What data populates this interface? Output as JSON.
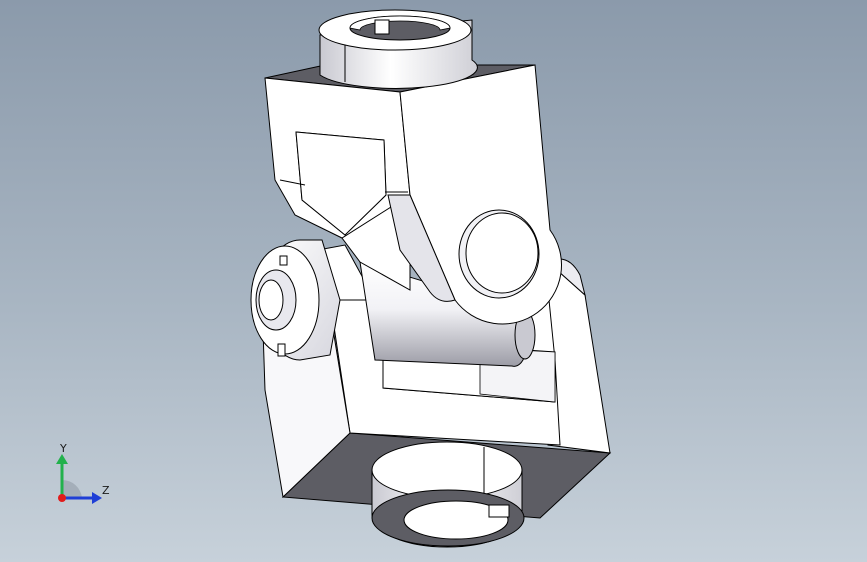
{
  "viewport": {
    "background_top": "#8b9aab",
    "background_bottom": "#c7d1da",
    "model": {
      "name": "universal-joint",
      "face_light": "#ffffff",
      "face_mid": "#cfcfd6",
      "face_dark": "#5d5d64",
      "edge_color": "#000000"
    }
  },
  "triad": {
    "y_label": "Y",
    "z_label": "Z",
    "y_color": "#22b14c",
    "z_color": "#1f3fd6",
    "x_color": "#e11b1b"
  }
}
